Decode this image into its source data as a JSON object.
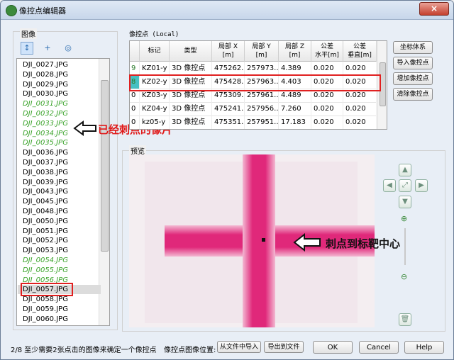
{
  "window": {
    "title": "像控点编辑器",
    "close_label": "×"
  },
  "left": {
    "section_title": "图像",
    "images": [
      {
        "name": "DJI_0027.JPG",
        "done": false
      },
      {
        "name": "DJI_0028.JPG",
        "done": false
      },
      {
        "name": "DJI_0029.JPG",
        "done": false
      },
      {
        "name": "DJI_0030.JPG",
        "done": false
      },
      {
        "name": "DJI_0031.JPG",
        "done": true
      },
      {
        "name": "DJI_0032.JPG",
        "done": true
      },
      {
        "name": "DJI_0033.JPG",
        "done": true
      },
      {
        "name": "DJI_0034.JPG",
        "done": true
      },
      {
        "name": "DJI_0035.JPG",
        "done": true
      },
      {
        "name": "DJI_0036.JPG",
        "done": false
      },
      {
        "name": "DJI_0037.JPG",
        "done": false
      },
      {
        "name": "DJI_0038.JPG",
        "done": false
      },
      {
        "name": "DJI_0039.JPG",
        "done": false
      },
      {
        "name": "DJI_0043.JPG",
        "done": false
      },
      {
        "name": "DJI_0045.JPG",
        "done": false
      },
      {
        "name": "DJI_0048.JPG",
        "done": false
      },
      {
        "name": "DJI_0050.JPG",
        "done": false
      },
      {
        "name": "DJI_0051.JPG",
        "done": false
      },
      {
        "name": "DJI_0052.JPG",
        "done": false
      },
      {
        "name": "DJI_0053.JPG",
        "done": false
      },
      {
        "name": "DJI_0054.JPG",
        "done": true
      },
      {
        "name": "DJI_0055.JPG",
        "done": true
      },
      {
        "name": "DJI_0056.JPG",
        "done": true
      },
      {
        "name": "DJI_0057.JPG",
        "done": false,
        "selected": true
      },
      {
        "name": "DJI_0058.JPG",
        "done": false
      },
      {
        "name": "DJI_0059.JPG",
        "done": false
      },
      {
        "name": "DJI_0060.JPG",
        "done": false
      }
    ],
    "annotation": "已经刺点的像片"
  },
  "gcp": {
    "section_title": "像控点 (Local)",
    "headers": [
      "",
      "标记",
      "类型",
      "局部 X\n[m]",
      "局部 Y\n[m]",
      "局部 Z\n[m]",
      "公差\n水平[m]",
      "公差\n垂直[m]"
    ],
    "rows": [
      {
        "count": "9",
        "mark": "KZ01-y",
        "type": "3D 像控点",
        "x": "475262...",
        "y": "257973...",
        "z": "4.389",
        "tol_h": "0.020",
        "tol_v": "0.020"
      },
      {
        "count": "8",
        "mark": "KZ02-y",
        "type": "3D 像控点",
        "x": "475428...",
        "y": "257963...",
        "z": "4.403",
        "tol_h": "0.020",
        "tol_v": "0.020",
        "selected": true
      },
      {
        "count": "0",
        "mark": "KZ03-y",
        "type": "3D 像控点",
        "x": "475309...",
        "y": "257961...",
        "z": "4.489",
        "tol_h": "0.020",
        "tol_v": "0.020"
      },
      {
        "count": "0",
        "mark": "KZ04-y",
        "type": "3D 像控点",
        "x": "475241...",
        "y": "257956...",
        "z": "7.260",
        "tol_h": "0.020",
        "tol_v": "0.020"
      },
      {
        "count": "0",
        "mark": "kz05-y",
        "type": "3D 像控点",
        "x": "475351...",
        "y": "257951...",
        "z": "17.183",
        "tol_h": "0.020",
        "tol_v": "0.020"
      }
    ],
    "buttons": [
      "坐标体系",
      "导入像控点",
      "增加像控点",
      "清除像控点"
    ]
  },
  "preview": {
    "section_title": "预览",
    "annotation": "刺点到标靶中心",
    "colors": {
      "cross": "#e0287a",
      "cross_light": "#f07ab0",
      "bg": "#f3e8ee"
    }
  },
  "footer": {
    "status": "2/8 至少需要2张点击的图像来确定一个像控点",
    "position_label": "像控点图像位置:",
    "import_btn": "从文件中导入",
    "export_btn": "导出到文件",
    "ok": "OK",
    "cancel": "Cancel",
    "help": "Help"
  }
}
